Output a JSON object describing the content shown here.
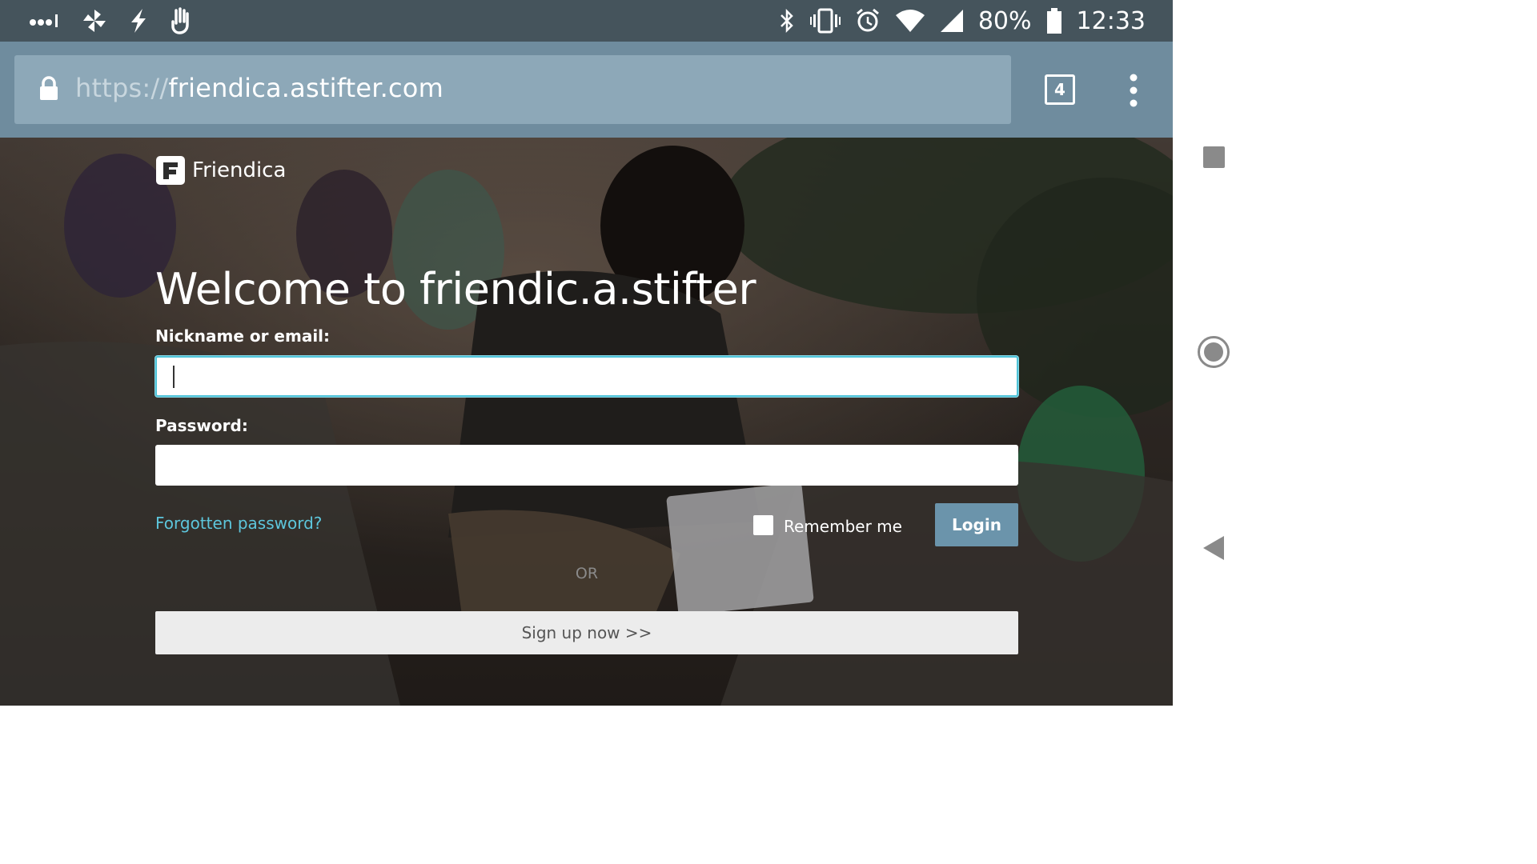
{
  "status_bar": {
    "battery": "80%",
    "time": "12:33",
    "icons": [
      "signal-dots-icon",
      "pinwheel-icon",
      "lightning-icon",
      "hand-icon",
      "bluetooth-icon",
      "vibrate-icon",
      "alarm-icon",
      "wifi-icon",
      "cell-signal-icon",
      "battery-icon"
    ]
  },
  "browser": {
    "url_scheme": "https://",
    "url_host": "friendica.astifter.com",
    "tab_count": "4"
  },
  "page": {
    "brand": "Friendica",
    "heading": "Welcome to friendic.a.stifter",
    "nickname_label": "Nickname or email:",
    "nickname_value": "",
    "password_label": "Password:",
    "password_value": "",
    "forgot_link": "Forgotten password?",
    "remember_label": "Remember me",
    "remember_checked": false,
    "login_button": "Login",
    "or_separator": "OR",
    "signup_button": "Sign up now >>"
  },
  "colors": {
    "status_bar_bg": "#45545c",
    "toolbar_bg": "#6f8c9e",
    "accent_link": "#5dc6dc",
    "login_button_bg": "#6b94ab",
    "focus_ring": "#4fc3d8"
  }
}
